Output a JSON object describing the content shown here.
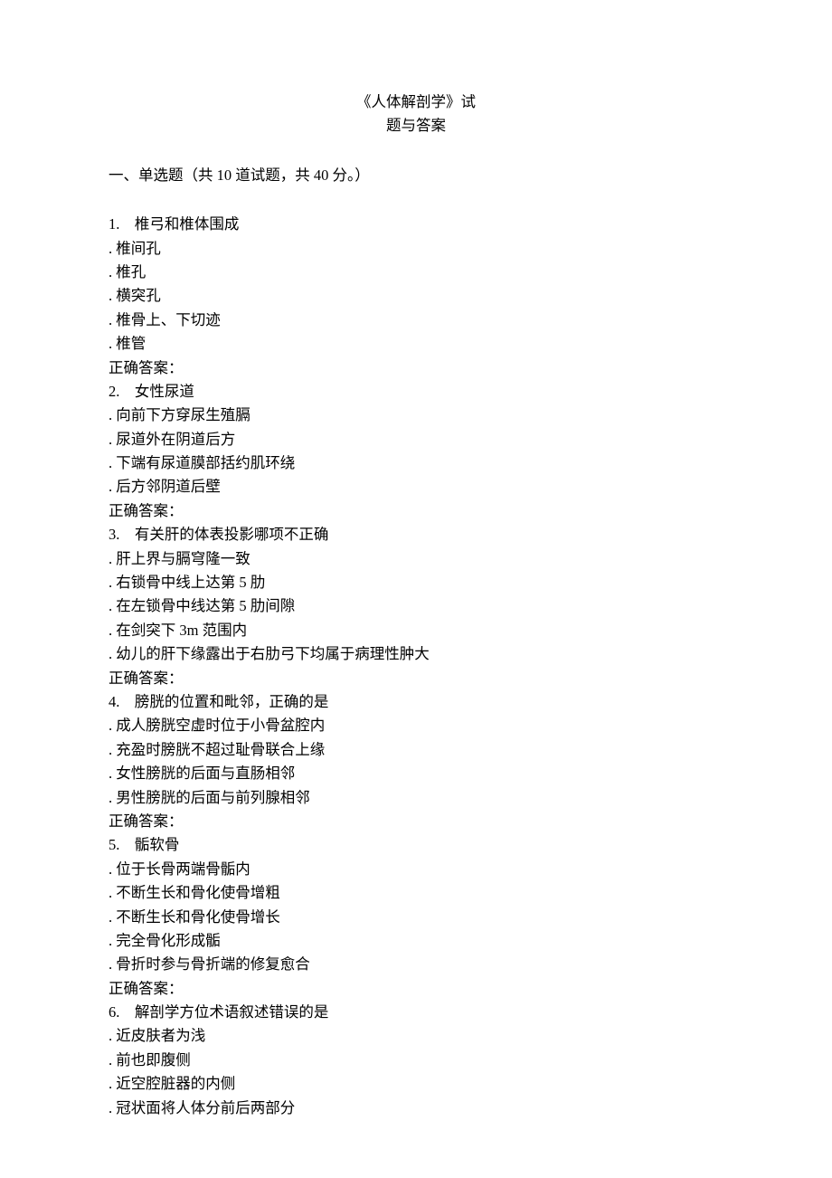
{
  "title": {
    "line1": "《人体解剖学》试",
    "line2": "题与答案"
  },
  "section_heading": "一、单选题（共 10 道试题，共 40 分。）",
  "answer_label": "正确答案：",
  "questions": [
    {
      "number": "1.",
      "stem": "椎弓和椎体围成",
      "options": [
        ". 椎间孔",
        ". 椎孔",
        ". 横突孔",
        ". 椎骨上、下切迹",
        ". 椎管"
      ]
    },
    {
      "number": "2.",
      "stem": "女性尿道",
      "options": [
        ". 向前下方穿尿生殖膈",
        ". 尿道外在阴道后方",
        ". 下端有尿道膜部括约肌环绕",
        ". 后方邻阴道后壁"
      ]
    },
    {
      "number": "3.",
      "stem": "有关肝的体表投影哪项不正确",
      "options": [
        ". 肝上界与膈穹隆一致",
        ". 右锁骨中线上达第 5 肋",
        ". 在左锁骨中线达第 5 肋间隙",
        ". 在剑突下 3m 范围内",
        ". 幼儿的肝下缘露出于右肋弓下均属于病理性肿大"
      ]
    },
    {
      "number": "4.",
      "stem": "膀胱的位置和毗邻，正确的是",
      "options": [
        ". 成人膀胱空虚时位于小骨盆腔内",
        ". 充盈时膀胱不超过耻骨联合上缘",
        ". 女性膀胱的后面与直肠相邻",
        ". 男性膀胱的后面与前列腺相邻"
      ]
    },
    {
      "number": "5.",
      "stem": "骺软骨",
      "options": [
        ". 位于长骨两端骨骺内",
        ". 不断生长和骨化使骨增粗",
        ". 不断生长和骨化使骨增长",
        ". 完全骨化形成骺",
        ". 骨折时参与骨折端的修复愈合"
      ]
    },
    {
      "number": "6.",
      "stem": "解剖学方位术语叙述错误的是",
      "options": [
        ". 近皮肤者为浅",
        ". 前也即腹侧",
        ". 近空腔脏器的内侧",
        ". 冠状面将人体分前后两部分"
      ],
      "show_answer": false
    }
  ]
}
